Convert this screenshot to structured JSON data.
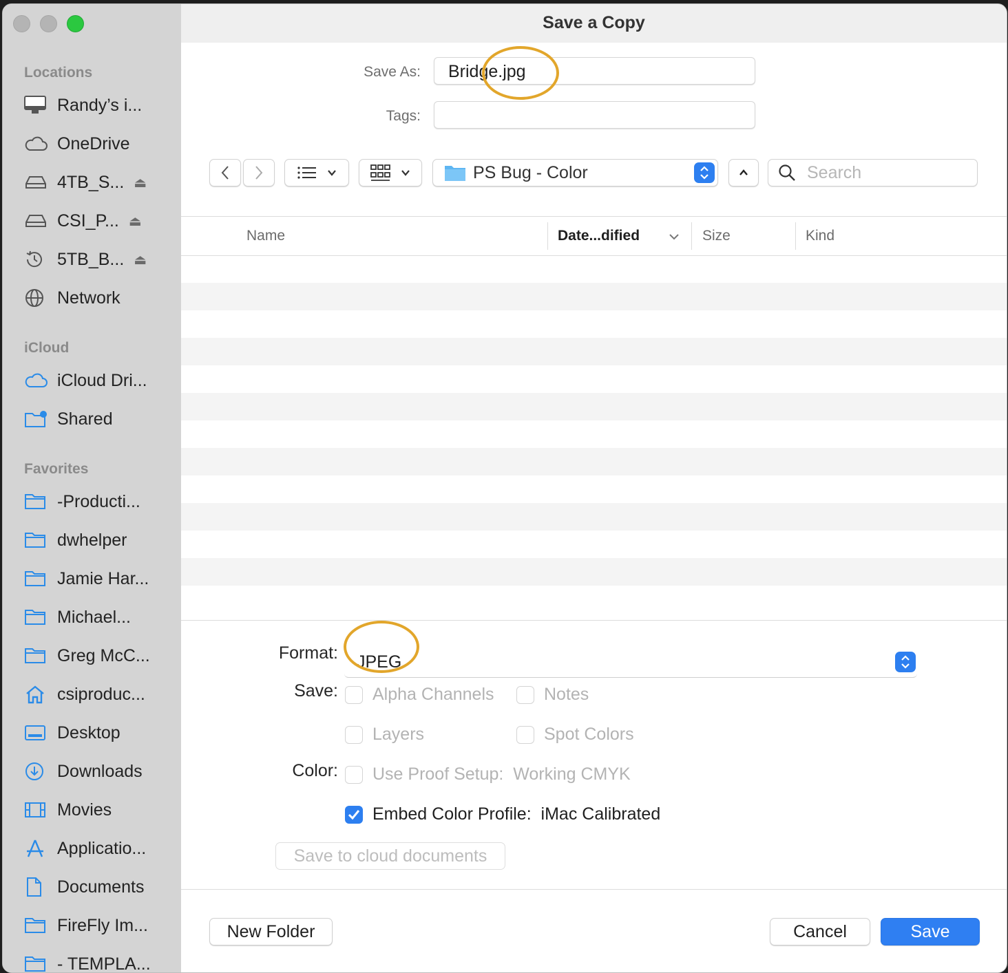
{
  "window": {
    "title": "Save a Copy"
  },
  "sidebar": {
    "sections": [
      {
        "title": "Locations",
        "items": [
          {
            "label": "Randy’s i...",
            "icon": "imac-icon"
          },
          {
            "label": "OneDrive",
            "icon": "cloud-icon"
          },
          {
            "label": "4TB_S...",
            "icon": "drive-icon",
            "eject": true
          },
          {
            "label": "CSI_P...",
            "icon": "drive-icon",
            "eject": true
          },
          {
            "label": "5TB_B...",
            "icon": "time-machine-icon",
            "eject": true
          },
          {
            "label": "Network",
            "icon": "globe-icon"
          }
        ]
      },
      {
        "title": "iCloud",
        "items": [
          {
            "label": "iCloud Dri...",
            "icon": "icloud-icon"
          },
          {
            "label": "Shared",
            "icon": "shared-folder-icon"
          }
        ]
      },
      {
        "title": "Favorites",
        "items": [
          {
            "label": "-Producti...",
            "icon": "folder-icon"
          },
          {
            "label": "dwhelper",
            "icon": "folder-icon"
          },
          {
            "label": "Jamie Har...",
            "icon": "folder-icon"
          },
          {
            "label": "Michael...",
            "icon": "folder-icon"
          },
          {
            "label": "Greg McC...",
            "icon": "folder-icon"
          },
          {
            "label": "csiproduc...",
            "icon": "home-icon"
          },
          {
            "label": "Desktop",
            "icon": "desktop-icon"
          },
          {
            "label": "Downloads",
            "icon": "downloads-icon"
          },
          {
            "label": "Movies",
            "icon": "movies-icon"
          },
          {
            "label": "Applicatio...",
            "icon": "applications-icon"
          },
          {
            "label": "Documents",
            "icon": "document-icon"
          },
          {
            "label": "FireFly Im...",
            "icon": "folder-icon"
          },
          {
            "label": "- TEMPLA...",
            "icon": "folder-icon"
          }
        ]
      }
    ],
    "eject_glyph": "⏏"
  },
  "form": {
    "save_as_label": "Save As:",
    "save_as_value": "Bridge.jpg",
    "tags_label": "Tags:",
    "tags_value": ""
  },
  "toolbar": {
    "location": "PS Bug - Color",
    "search_placeholder": "Search"
  },
  "columns": {
    "name": "Name",
    "date": "Date...dified",
    "size": "Size",
    "kind": "Kind"
  },
  "options": {
    "format_label": "Format:",
    "format_value": "JPEG",
    "save_label": "Save:",
    "color_label": "Color:",
    "alpha_channels": "Alpha Channels",
    "notes": "Notes",
    "layers": "Layers",
    "spot_colors": "Spot Colors",
    "use_proof_setup": "Use Proof Setup:  Working CMYK",
    "embed_color_profile": "Embed Color Profile:  iMac Calibrated",
    "embed_checked": true,
    "cloud_button": "Save to cloud documents"
  },
  "footer": {
    "new_folder": "New Folder",
    "cancel": "Cancel",
    "save": "Save"
  },
  "colors": {
    "accent": "#2f7ff2",
    "highlight": "#e2a62b",
    "sidebar_bg": "#d4d4d4"
  }
}
